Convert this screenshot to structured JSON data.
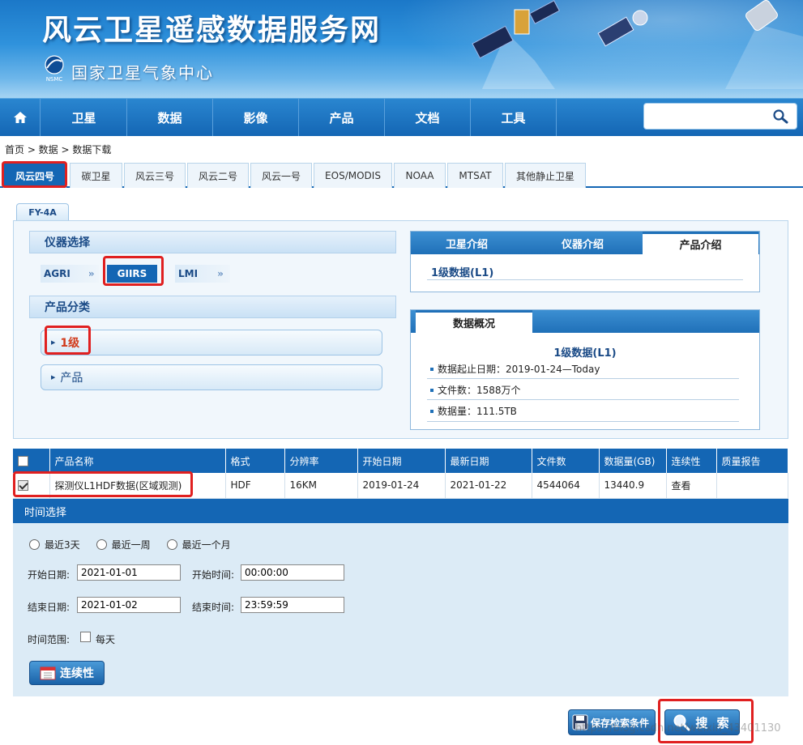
{
  "header": {
    "site_title": "风云卫星遥感数据服务网",
    "org_name": "国家卫星气象中心",
    "org_logo_text": "NSMC"
  },
  "nav": {
    "home_icon": "home-icon",
    "items": [
      "卫星",
      "数据",
      "影像",
      "产品",
      "文档",
      "工具"
    ],
    "search_value": "",
    "search_icon": "search-icon"
  },
  "breadcrumb": "首页 > 数据 > 数据下载",
  "satellite_tabs": [
    "风云四号",
    "碳卫星",
    "风云三号",
    "风云二号",
    "风云一号",
    "EOS/MODIS",
    "NOAA",
    "MTSAT",
    "其他静止卫星"
  ],
  "active_satellite_tab": "风云四号",
  "subtab": "FY-4A",
  "instrument": {
    "heading": "仪器选择",
    "items": [
      "AGRI",
      "GIIRS",
      "LMI"
    ],
    "active": "GIIRS"
  },
  "category": {
    "heading": "产品分类",
    "items": [
      "1级",
      "产品"
    ],
    "active": "1级"
  },
  "intro_box": {
    "tabs": [
      "卫星介绍",
      "仪器介绍",
      "产品介绍"
    ],
    "active_tab": "产品介绍",
    "content_title": "1级数据(L1)"
  },
  "overview_box": {
    "tab": "数据概况",
    "title": "1级数据(L1)",
    "rows": [
      "数据起止日期：2019-01-24—Today",
      "文件数：1588万个",
      "数据量：111.5TB"
    ]
  },
  "results_table": {
    "headers": [
      "",
      "产品名称",
      "格式",
      "分辨率",
      "开始日期",
      "最新日期",
      "文件数",
      "数据量(GB)",
      "连续性",
      "质量报告"
    ],
    "rows": [
      {
        "checked": true,
        "name": "探测仪L1HDF数据(区域观测)",
        "format": "HDF",
        "resolution": "16KM",
        "start_date": "2019-01-24",
        "latest_date": "2021-01-22",
        "file_count": "4544064",
        "data_size": "13440.9",
        "continuity": "查看",
        "quality_report": ""
      }
    ]
  },
  "time_selection": {
    "heading": "时间选择",
    "radio_options": [
      "最近3天",
      "最近一周",
      "最近一个月"
    ],
    "start_date_label": "开始日期:",
    "start_date": "2021-01-01",
    "start_time_label": "开始时间:",
    "start_time": "00:00:00",
    "end_date_label": "结束日期:",
    "end_date": "2021-01-02",
    "end_time_label": "结束时间:",
    "end_time": "23:59:59",
    "range_label": "时间范围:",
    "daily_label": "每天",
    "daily_checked": false,
    "continuity_button": "连续性"
  },
  "actions": {
    "save_button": "保存检索条件",
    "search_button": "搜 索"
  },
  "watermark": "https://blog.csdn.net/weixin_43401130",
  "colors": {
    "nav_blue": "#1466b4",
    "highlight_red": "#e02020",
    "panel_bg": "#dcebf6"
  }
}
